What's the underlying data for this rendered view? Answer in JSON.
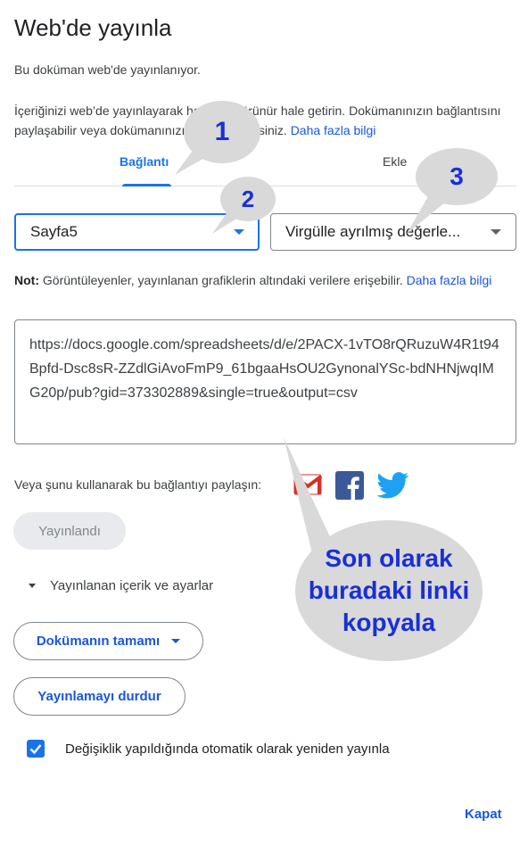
{
  "dialog": {
    "title": "Web'de yayınla",
    "status": "Bu doküman web'de yayınlanıyor.",
    "description": "İçeriğinizi web’de yayınlayarak herkese görünür hale getirin. Dokümanınızın bağlantısını paylaşabilir veya dokümanınızı yerleştirebilirsiniz.",
    "learn_more": "Daha fazla bilgi"
  },
  "tabs": [
    {
      "label": "Bağlantı",
      "active": true
    },
    {
      "label": "Ekle",
      "active": false
    }
  ],
  "sheet_select": {
    "value": "Sayfa5"
  },
  "format_select": {
    "value": "Virgülle ayrılmış değerle..."
  },
  "note": {
    "prefix": "Not:",
    "text": " Görüntüleyenler, yayınlanan grafiklerin altındaki verilere erişebilir.",
    "link": "Daha fazla bilgi"
  },
  "publish_url": "https://docs.google.com/spreadsheets/d/e/2PACX-1vTO8rQRuzuW4R1t94Bpfd-Dsc8sR-ZZdlGiAvoFmP9_61bgaaHsOU2GynonalYSc-bdNHNjwqIMG20p/pub?gid=373302889&single=true&output=csv",
  "share": {
    "label": "Veya şunu kullanarak bu bağlantıyı paylaşın:",
    "icons": [
      "gmail-icon",
      "facebook-icon",
      "twitter-icon"
    ]
  },
  "published_button": "Yayınlandı",
  "settings": {
    "expander_label": "Yayınlanan içerik ve ayarlar",
    "scope_button": "Dokümanın tamamı",
    "stop_button": "Yayınlamayı durdur",
    "auto_republish_label": "Değişiklik yapıldığında otomatik olarak yeniden yayınla",
    "auto_republish_checked": true
  },
  "close_button": "Kapat",
  "annotations": {
    "step1": "1",
    "step2": "2",
    "step3": "3",
    "final_line1": "Son olarak",
    "final_line2": "buradaki linki",
    "final_line3": "kopyala"
  },
  "colors": {
    "accent": "#1a73e8",
    "link": "#1a56db",
    "annotation_text": "#1a2fd6",
    "annotation_bubble": "#d9d9d9"
  }
}
